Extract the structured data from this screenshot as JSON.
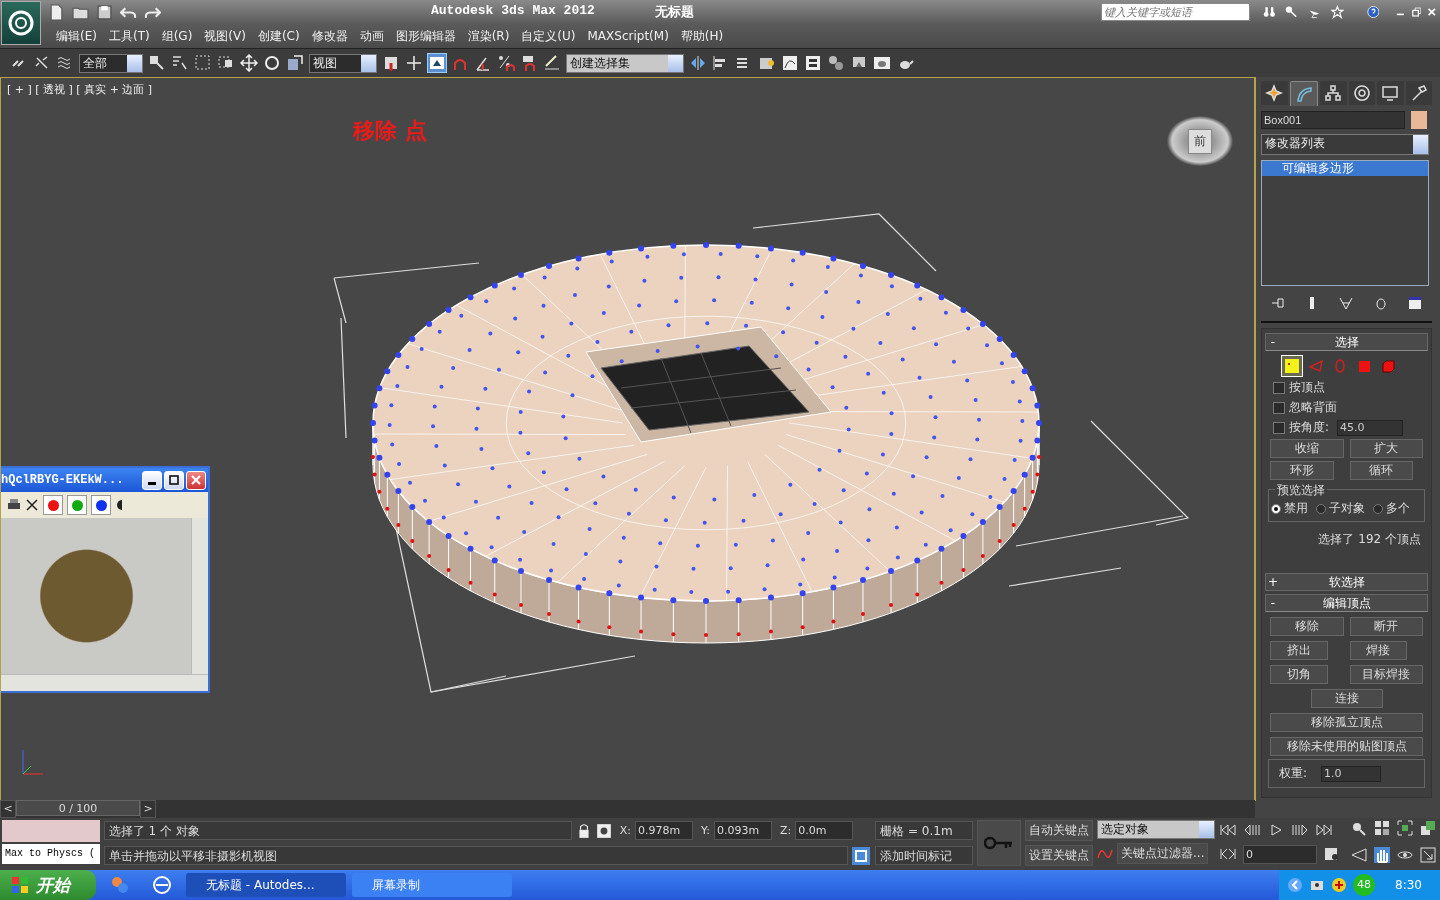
{
  "title_bar": {
    "app_title": "Autodesk 3ds Max  2012",
    "document": "无标题",
    "search_placeholder": "键入关键字或短语"
  },
  "menu": [
    "编辑(E)",
    "工具(T)",
    "组(G)",
    "视图(V)",
    "创建(C)",
    "修改器",
    "动画",
    "图形编辑器",
    "渲染(R)",
    "自定义(U)",
    "MAXScript(M)",
    "帮助(H)"
  ],
  "toolbar": {
    "selection_filter": "全部",
    "reference_coord": "视图",
    "named_selection": "创建选择集"
  },
  "viewport": {
    "label": "[ + ] [ 透视 ] [ 真实 + 边面 ]",
    "overlay_text": "移除 点",
    "viewcube_label": "前"
  },
  "floating_window": {
    "title": "hQclRBYG-EKEkW...",
    "color_buttons": [
      {
        "color": "#ee1111"
      },
      {
        "color": "#11aa11"
      },
      {
        "color": "#1133ee"
      }
    ]
  },
  "command_panel": {
    "tabs": [
      {
        "kind": "create",
        "selected": false
      },
      {
        "kind": "modify",
        "selected": true
      },
      {
        "kind": "hierarchy",
        "selected": false
      },
      {
        "kind": "motion",
        "selected": false
      },
      {
        "kind": "display",
        "selected": false
      },
      {
        "kind": "utilities",
        "selected": false
      }
    ],
    "object_name": "Box001",
    "modifier_list": "修改器列表",
    "stack": [
      {
        "label": "可编辑多边形",
        "selected": true
      }
    ],
    "selection": {
      "title": "选择",
      "toggle": "-",
      "expanded": true,
      "levels": [
        {
          "kind": "vertex",
          "selected": true
        },
        {
          "kind": "edge",
          "selected": false
        },
        {
          "kind": "border",
          "selected": false
        },
        {
          "kind": "polygon",
          "selected": false
        },
        {
          "kind": "element",
          "selected": false
        }
      ],
      "checkboxes": [
        {
          "label": "按顶点",
          "checked": false
        },
        {
          "label": "忽略背面",
          "checked": false
        },
        {
          "label": "按角度:",
          "checked": false,
          "value": "45.0"
        }
      ],
      "buttons": [
        {
          "label": "收缩",
          "kind": "plain"
        },
        {
          "label": "扩大",
          "kind": "plain"
        },
        {
          "label": "环形",
          "kind": "spinner"
        },
        {
          "label": "循环",
          "kind": "spinner"
        }
      ],
      "preview_title": "预览选择",
      "preview": [
        {
          "label": "禁用",
          "selected": true
        },
        {
          "label": "子对象",
          "selected": false
        },
        {
          "label": "多个",
          "selected": false
        }
      ],
      "status": "选择了 192 个顶点"
    },
    "soft_selection": {
      "title": "软选择",
      "toggle": "+",
      "expanded": false
    },
    "edit_vertices": {
      "title": "编辑顶点",
      "toggle": "-",
      "expanded": true,
      "buttons": [
        {
          "label": "移除",
          "kind": "half"
        },
        {
          "label": "断开",
          "kind": "half"
        },
        {
          "label": "挤出",
          "kind": "half_settings"
        },
        {
          "label": "焊接",
          "kind": "half_settings"
        },
        {
          "label": "切角",
          "kind": "half_settings"
        },
        {
          "label": "目标焊接",
          "kind": "half"
        },
        {
          "label": "连接",
          "kind": "center"
        },
        {
          "label": "移除孤立顶点",
          "kind": "full"
        },
        {
          "label": "移除未使用的贴图顶点",
          "kind": "full"
        }
      ],
      "weight_label": "权重:",
      "weight_value": "1.0"
    }
  },
  "timeline": {
    "position": "0 / 100",
    "prev": "<",
    "next": ">"
  },
  "status_bar": {
    "listener": "Max to Physcs (",
    "selection": "选择了 1 个 对象",
    "prompt": "单击并拖动以平移非摄影机视图",
    "x": "0.978m",
    "y": "0.093m",
    "z": "0.0m",
    "x_label": "X:",
    "y_label": "Y:",
    "z_label": "Z:",
    "grid": "栅格 = 0.1m",
    "time_tag": "添加时间标记",
    "auto_key": "自动关键点",
    "set_key": "设置关键点",
    "key_mode": "选定对象",
    "key_filters": "关键点过滤器...",
    "frame": "0"
  },
  "taskbar": {
    "start": "开始",
    "tasks": [
      {
        "label": "无标题 - Autodes...",
        "selected": true
      },
      {
        "label": "屏幕录制",
        "selected": false
      }
    ],
    "tray_badge": "48",
    "clock": "8:30"
  }
}
